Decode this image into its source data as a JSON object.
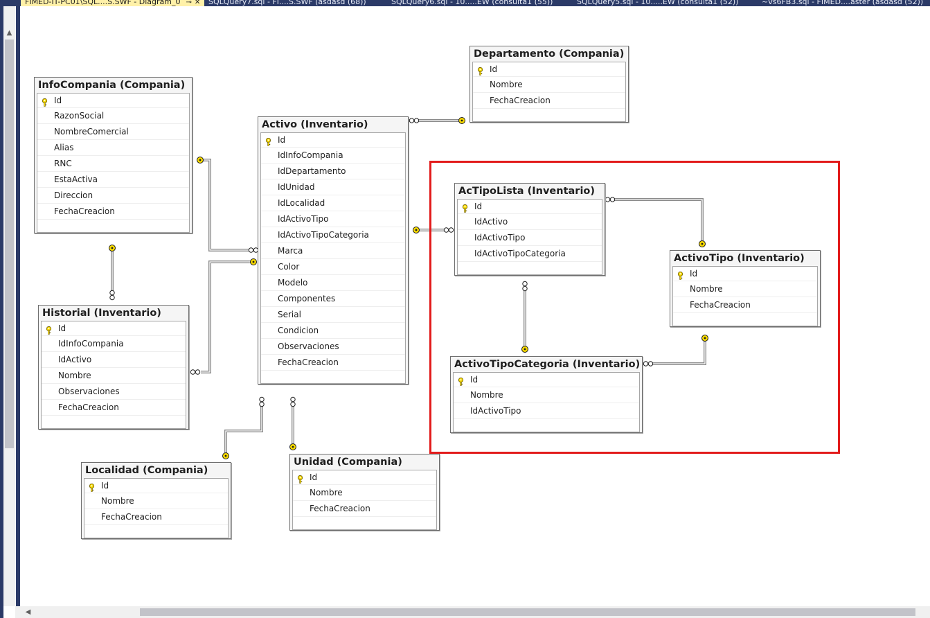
{
  "tabs": [
    {
      "label": "FIMED-IT-PC01\\SQL....S.SWF - Diagram_0",
      "active": true
    },
    {
      "label": "SQLQuery7.sql - FI....S.SWF (asdasd (68))",
      "active": false
    },
    {
      "label": "SQLQuery6.sql - 10.....EW (consulta1 (55))",
      "active": false
    },
    {
      "label": "SQLQuery5.sql - 10.....EW (consulta1 (52))",
      "active": false
    },
    {
      "label": "~vs6FB3.sql - FIMED....aster (asdasd (52))",
      "active": false
    }
  ],
  "tab_icons": {
    "pin": "pin-icon",
    "close": "close-icon"
  },
  "scrollbars": {
    "up": "▲",
    "down": "▼",
    "left": "◀"
  },
  "colors": {
    "highlight": "#e21b1b",
    "key": "#f5d800",
    "frame": "#2b3a67"
  },
  "tables": {
    "infocompania": {
      "title": "InfoCompania (Compania)",
      "columns": [
        "Id",
        "RazonSocial",
        "NombreComercial",
        "Alias",
        "RNC",
        "EstaActiva",
        "Direccion",
        "FechaCreacion"
      ]
    },
    "historial": {
      "title": "Historial (Inventario)",
      "columns": [
        "Id",
        "IdInfoCompania",
        "IdActivo",
        "Nombre",
        "Observaciones",
        "FechaCreacion"
      ]
    },
    "localidad": {
      "title": "Localidad (Compania)",
      "columns": [
        "Id",
        "Nombre",
        "FechaCreacion"
      ]
    },
    "activo": {
      "title": "Activo (Inventario)",
      "columns": [
        "Id",
        "IdInfoCompania",
        "IdDepartamento",
        "IdUnidad",
        "IdLocalidad",
        "IdActivoTipo",
        "IdActivoTipoCategoria",
        "Marca",
        "Color",
        "Modelo",
        "Componentes",
        "Serial",
        "Condicion",
        "Observaciones",
        "FechaCreacion"
      ]
    },
    "unidad": {
      "title": "Unidad (Compania)",
      "columns": [
        "Id",
        "Nombre",
        "FechaCreacion"
      ]
    },
    "departamento": {
      "title": "Departamento (Compania)",
      "columns": [
        "Id",
        "Nombre",
        "FechaCreacion"
      ]
    },
    "actipolista": {
      "title": "AcTipoLista (Inventario)",
      "columns": [
        "Id",
        "IdActivo",
        "IdActivoTipo",
        "IdActivoTipoCategoria"
      ]
    },
    "activotipo": {
      "title": "ActivoTipo (Inventario)",
      "columns": [
        "Id",
        "Nombre",
        "FechaCreacion"
      ]
    },
    "activotipocategoria": {
      "title": "ActivoTipoCategoria (Inventario)",
      "columns": [
        "Id",
        "Nombre",
        "IdActivoTipo"
      ]
    }
  }
}
